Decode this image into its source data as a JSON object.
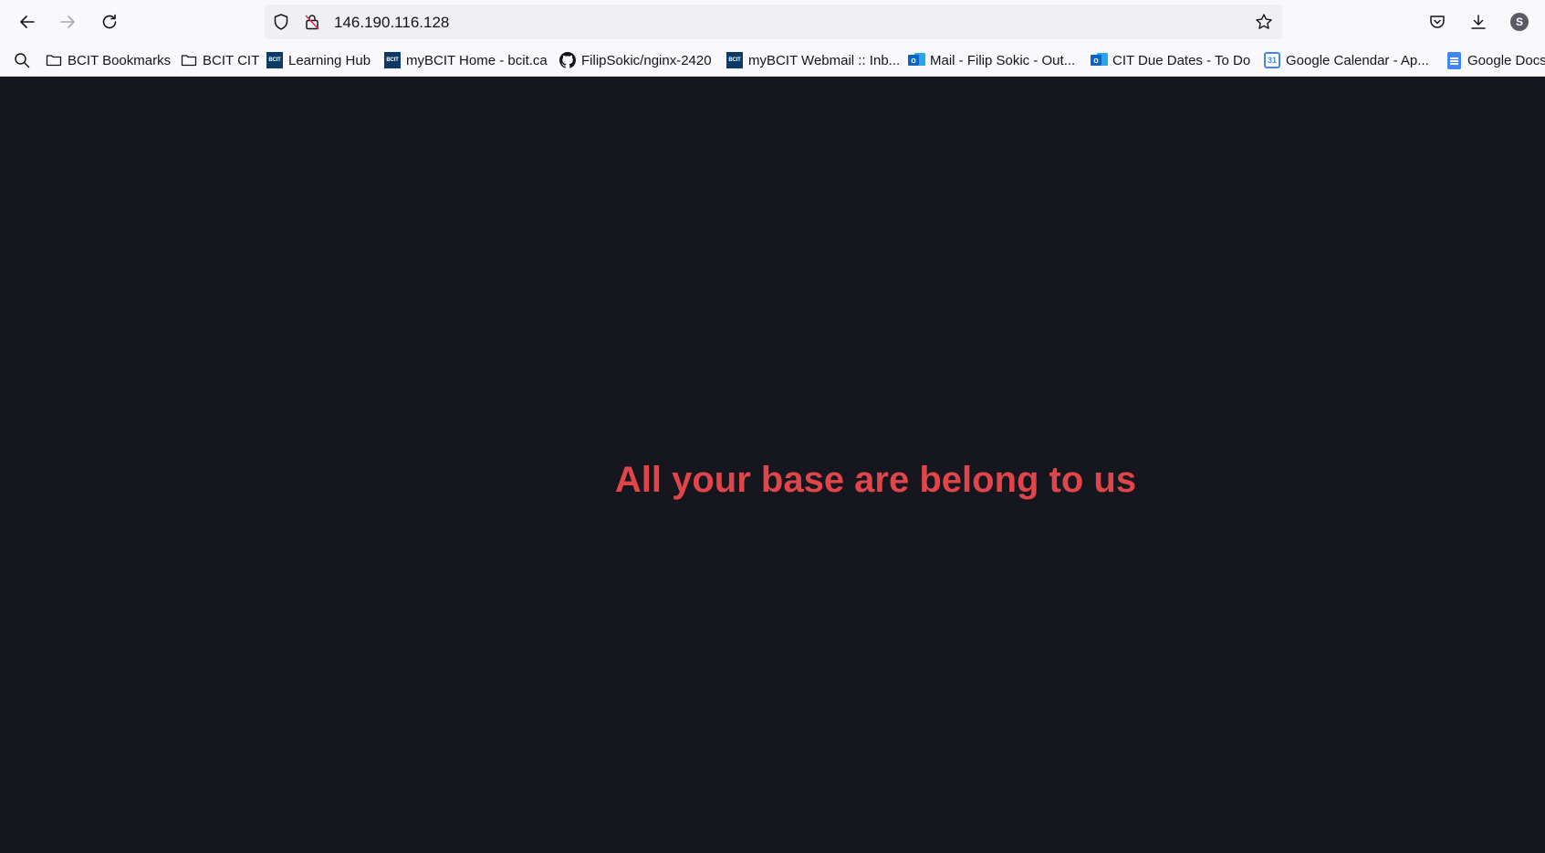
{
  "toolbar": {
    "back_icon": "arrow-left-icon",
    "forward_icon": "arrow-right-icon",
    "reload_icon": "reload-icon"
  },
  "urlbar": {
    "url": "146.190.116.128",
    "shield_icon": "shield-icon",
    "insecure_icon": "insecure-lock-icon",
    "bookmark_star_icon": "star-icon"
  },
  "right_toolbar": {
    "pocket_icon": "pocket-icon",
    "downloads_icon": "download-icon",
    "account_initial": "S"
  },
  "bookmarks": [
    {
      "label": "BCIT Bookmarks",
      "icon": "folder-icon"
    },
    {
      "label": "BCIT CIT",
      "icon": "folder-icon"
    },
    {
      "label": "Learning Hub",
      "icon": "bcit-icon",
      "icon_text": "BCIT"
    },
    {
      "label": "myBCIT Home - bcit.ca",
      "icon": "bcit-icon",
      "icon_text": "BCIT"
    },
    {
      "label": "FilipSokic/nginx-2420",
      "icon": "github-icon"
    },
    {
      "label": "myBCIT Webmail :: Inb...",
      "icon": "bcit-icon",
      "icon_text": "BCIT"
    },
    {
      "label": "Mail - Filip Sokic - Out...",
      "icon": "outlook-icon"
    },
    {
      "label": "CIT Due Dates - To Do",
      "icon": "outlook-icon"
    },
    {
      "label": "Google Calendar - Ap...",
      "icon": "google-calendar-icon",
      "icon_text": "31"
    },
    {
      "label": "Google Docs",
      "icon": "google-docs-icon"
    }
  ],
  "page": {
    "headline": "All your base are belong to us",
    "background_color": "#16161e",
    "headline_color": "#e0454a"
  }
}
